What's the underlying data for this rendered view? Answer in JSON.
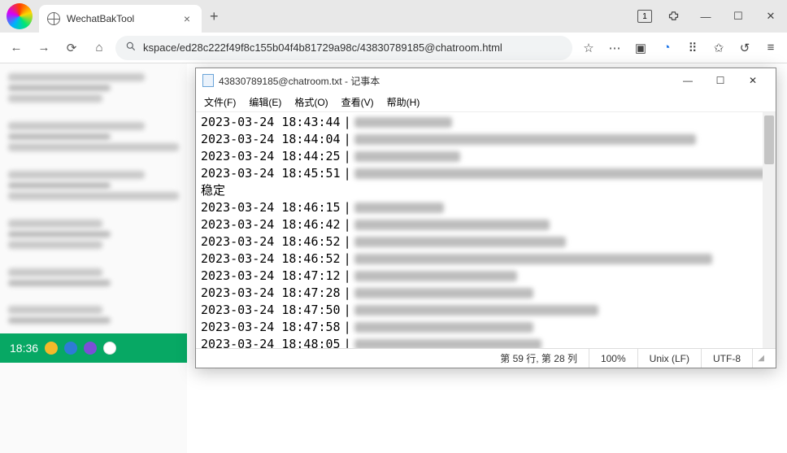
{
  "browser": {
    "tab_title": "WechatBakTool",
    "window_badge": "1",
    "url": "kspace/ed28c222f49f8c155b04f4b81729a98c/43830789185@chatroom.html"
  },
  "sidebar": {
    "selected_time": "18:36"
  },
  "notepad": {
    "title": "43830789185@chatroom.txt - 记事本",
    "menu": {
      "file": "文件(F)",
      "edit": "编辑(E)",
      "format": "格式(O)",
      "view": "查看(V)",
      "help": "帮助(H)"
    },
    "lines": [
      {
        "ts": "2023-03-24 18:43:44",
        "sep": "|",
        "blurw": 120
      },
      {
        "ts": "2023-03-24 18:44:04",
        "sep": "|",
        "blurw": 420
      },
      {
        "ts": "2023-03-24 18:44:25",
        "sep": "|",
        "blurw": 130
      },
      {
        "ts": "2023-03-24 18:45:51",
        "sep": "|",
        "blurw": 540
      },
      {
        "plain": "稳定"
      },
      {
        "ts": "2023-03-24 18:46:15",
        "sep": "|",
        "blurw": 110
      },
      {
        "ts": "2023-03-24 18:46:42",
        "sep": "|",
        "blurw": 240
      },
      {
        "ts": "2023-03-24 18:46:52",
        "sep": "|",
        "blurw": 260
      },
      {
        "ts": "2023-03-24 18:46:52",
        "sep": "|",
        "blurw": 440
      },
      {
        "ts": "2023-03-24 18:47:12",
        "sep": "|",
        "blurw": 200
      },
      {
        "ts": "2023-03-24 18:47:28",
        "sep": "|",
        "blurw": 220
      },
      {
        "ts": "2023-03-24 18:47:50",
        "sep": "|",
        "blurw": 300
      },
      {
        "ts": "2023-03-24 18:47:58",
        "sep": "|",
        "blurw": 220
      },
      {
        "ts": "2023-03-24 18:48:05",
        "sep": "|",
        "blurw": 230
      }
    ],
    "status": {
      "pos": "第 59 行, 第 28 列",
      "zoom": "100%",
      "eol": "Unix (LF)",
      "encoding": "UTF-8"
    }
  }
}
